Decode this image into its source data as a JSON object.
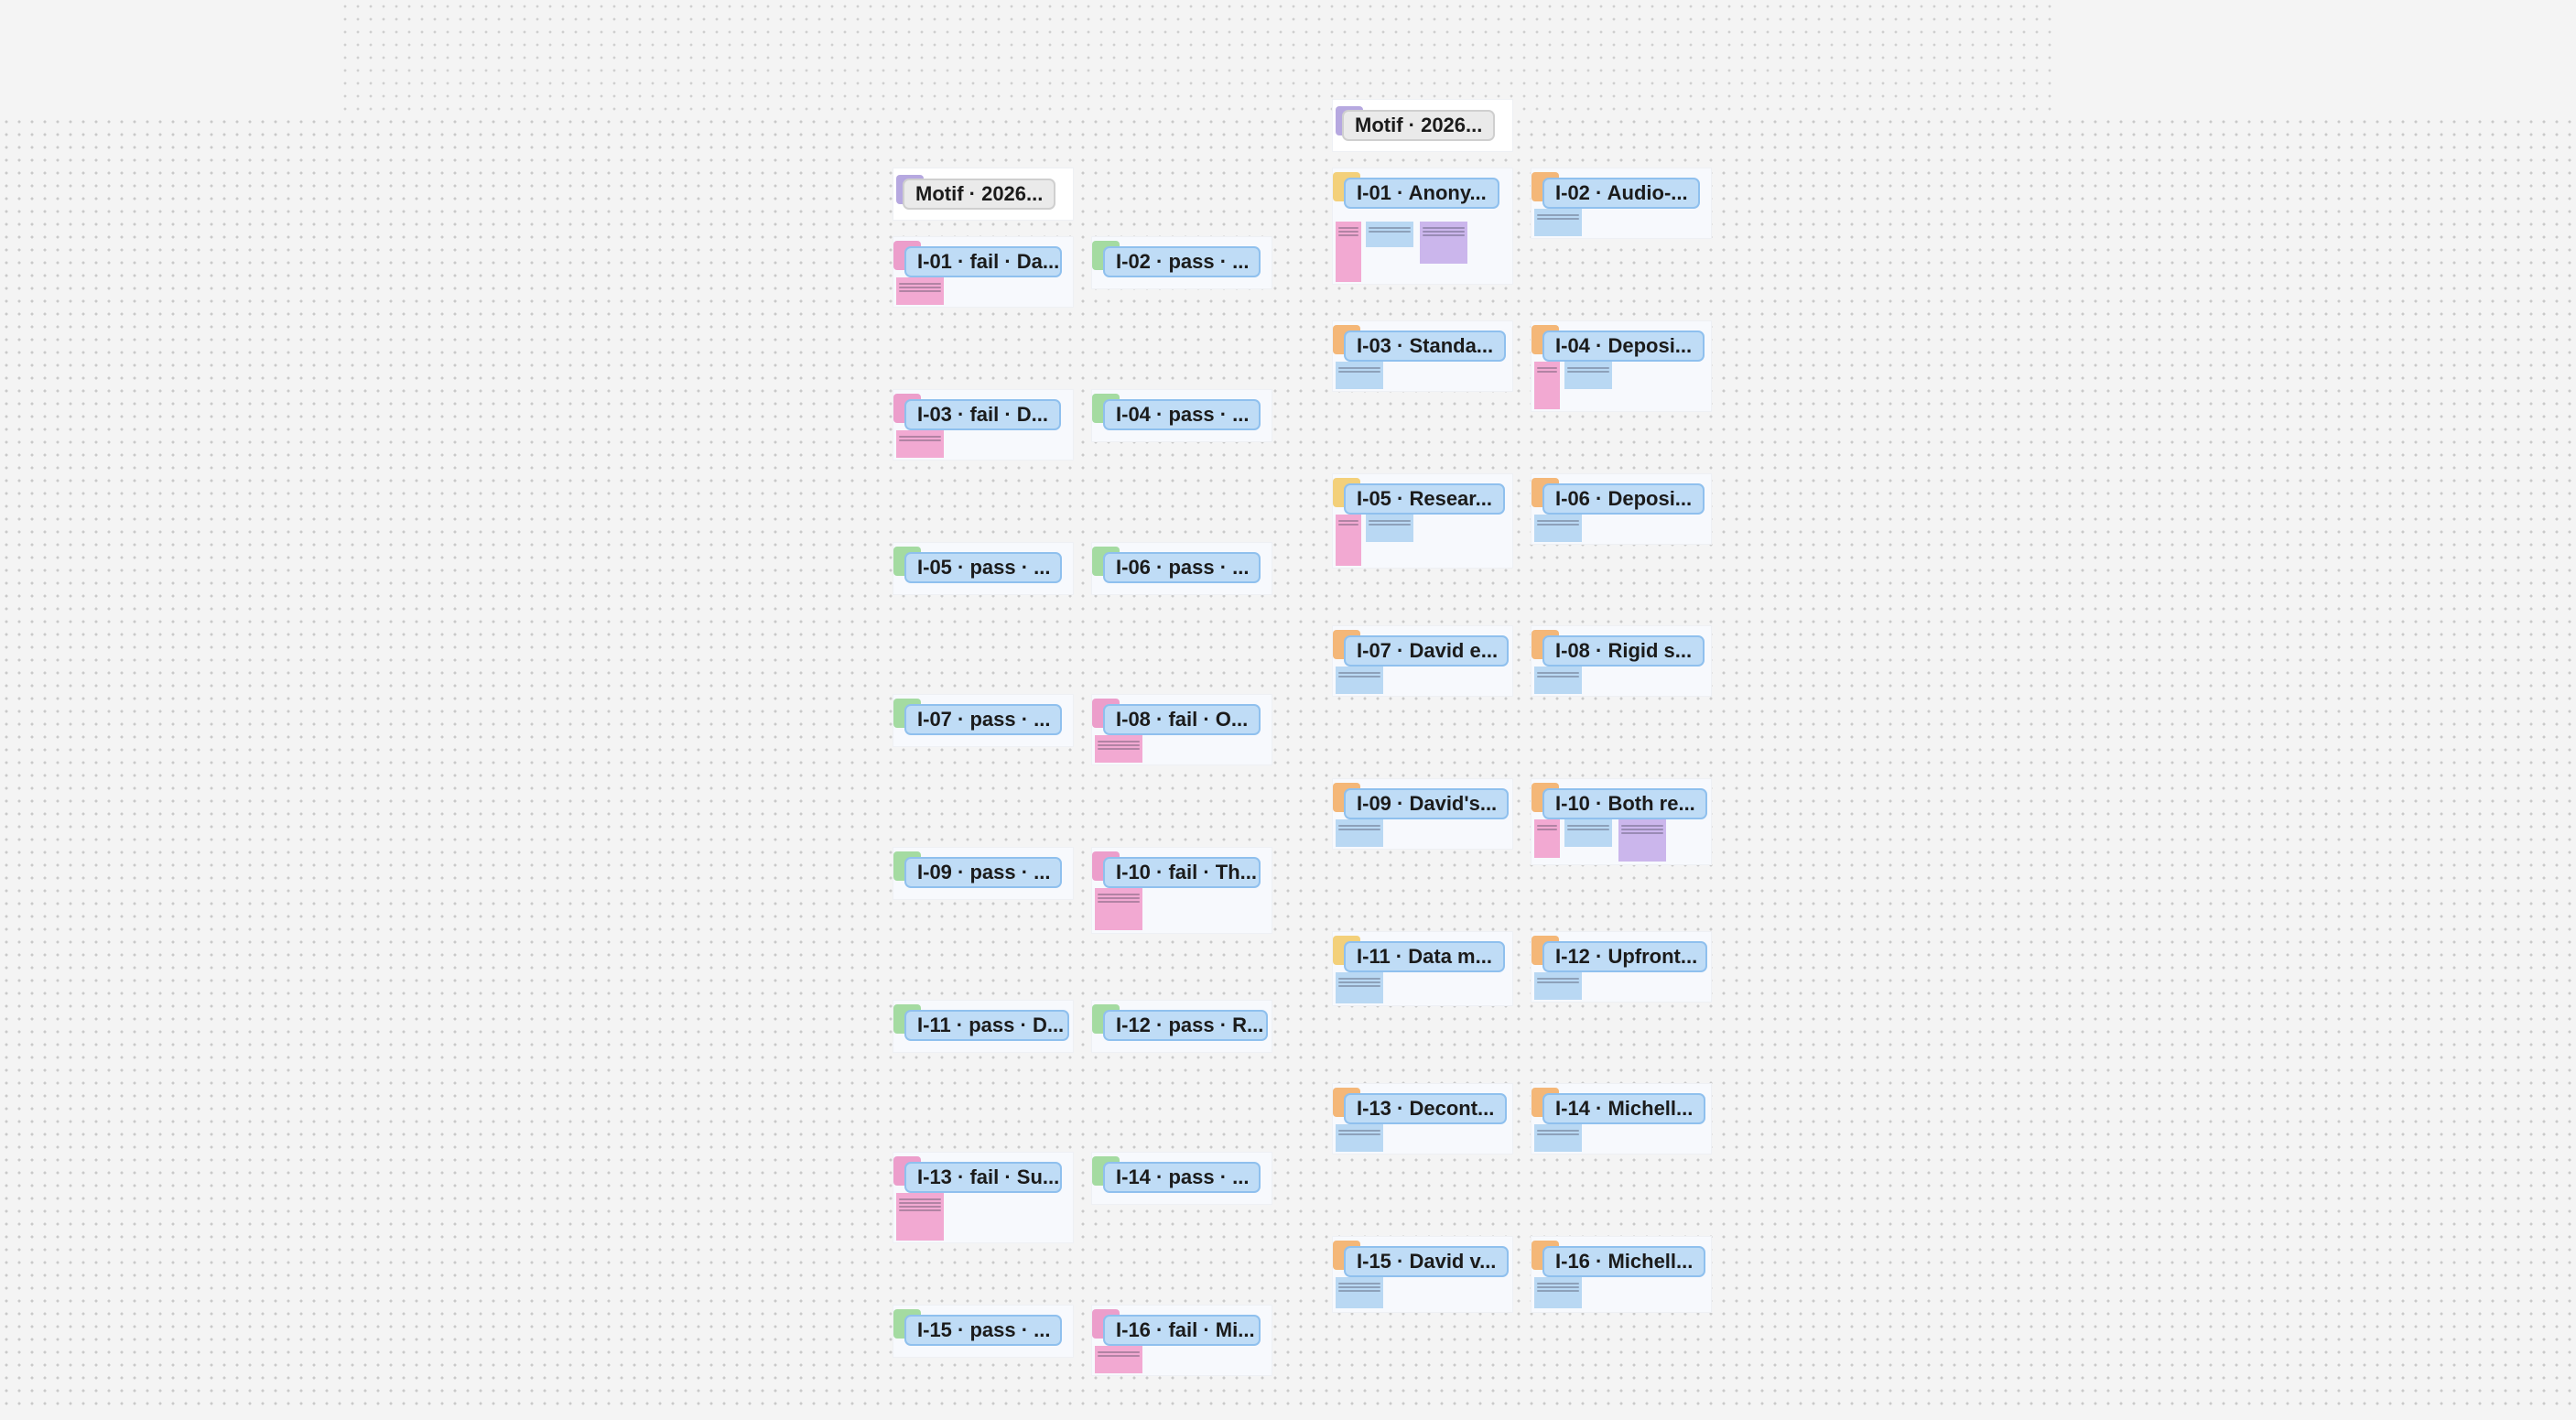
{
  "board": {
    "left_column": {
      "header": "Motif · 2026...",
      "items": [
        {
          "label": "I-01 · fail · Da...",
          "status": "fail"
        },
        {
          "label": "I-02 · pass · ...",
          "status": "pass"
        },
        {
          "label": "I-03 · fail · D...",
          "status": "fail"
        },
        {
          "label": "I-04 · pass · ...",
          "status": "pass"
        },
        {
          "label": "I-05 · pass · ...",
          "status": "pass"
        },
        {
          "label": "I-06 · pass · ...",
          "status": "pass"
        },
        {
          "label": "I-07 · pass · ...",
          "status": "pass"
        },
        {
          "label": "I-08 · fail · O...",
          "status": "fail"
        },
        {
          "label": "I-09 · pass · ...",
          "status": "pass"
        },
        {
          "label": "I-10 · fail · Th...",
          "status": "fail"
        },
        {
          "label": "I-11 · pass · D...",
          "status": "pass"
        },
        {
          "label": "I-12 · pass · R...",
          "status": "pass"
        },
        {
          "label": "I-13 · fail · Su...",
          "status": "fail"
        },
        {
          "label": "I-14 · pass · ...",
          "status": "pass"
        },
        {
          "label": "I-15 · pass · ...",
          "status": "pass"
        },
        {
          "label": "I-16 · fail · Mi...",
          "status": "fail"
        }
      ]
    },
    "right_column": {
      "header": "Motif · 2026...",
      "items": [
        {
          "label": "I-01 · Anony..."
        },
        {
          "label": "I-02 · Audio-..."
        },
        {
          "label": "I-03 · Standa..."
        },
        {
          "label": "I-04 · Deposi..."
        },
        {
          "label": "I-05 · Resear..."
        },
        {
          "label": "I-06 · Deposi..."
        },
        {
          "label": "I-07 · David e..."
        },
        {
          "label": "I-08 · Rigid s..."
        },
        {
          "label": "I-09 · David's..."
        },
        {
          "label": "I-10 · Both re..."
        },
        {
          "label": "I-11 · Data m..."
        },
        {
          "label": "I-12 · Upfront..."
        },
        {
          "label": "I-13 · Decont..."
        },
        {
          "label": "I-14 · Michell..."
        },
        {
          "label": "I-15 · David v..."
        },
        {
          "label": "I-16 · Michell..."
        }
      ]
    }
  },
  "colors": {
    "label_fill": "#bfdcf6",
    "label_border": "#8fc0ee",
    "pass": "#a4dba1",
    "fail": "#ec9ecb",
    "motif": "#b6a8e0",
    "note_yellow": "#f3d07a",
    "note_orange": "#f4b778"
  }
}
